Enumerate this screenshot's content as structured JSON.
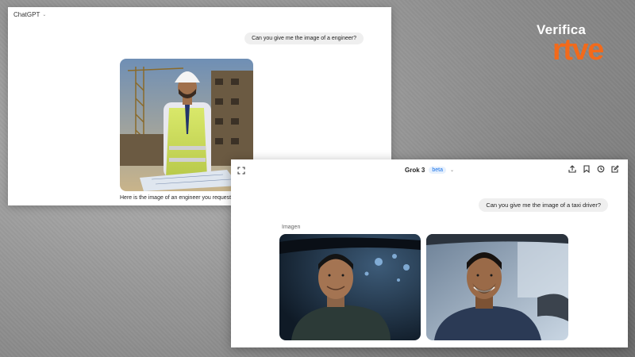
{
  "logo": {
    "verifica": "Verifica",
    "rtve": "rtve"
  },
  "chatgpt": {
    "title": "ChatGPT",
    "user_message": "Can you give me the image of a engineer?",
    "image_icon": "generated-engineer-photo",
    "caption": "Here is the image of an engineer you requested."
  },
  "grok": {
    "title": "Grok 3",
    "badge": "beta",
    "user_message": "Can you give me the image of a taxi driver?",
    "images_label": "Imagen",
    "images": [
      "taxi-driver-photo-1",
      "taxi-driver-photo-2"
    ],
    "icons": [
      "expand-icon",
      "share-icon",
      "bookmark-icon",
      "history-icon",
      "edit-icon"
    ]
  },
  "colors": {
    "rtve_orange": "#f26a1b",
    "badge_blue": "#1a73e8"
  }
}
